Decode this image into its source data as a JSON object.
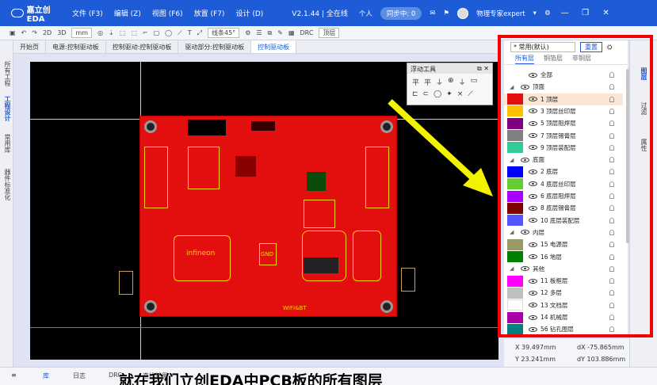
{
  "titlebar": {
    "app_name": "嘉立创EDA",
    "menus": [
      "文件 (F3)",
      "编辑 (Z)",
      "视图 (F6)",
      "放置 (F7)",
      "设计 (D)"
    ],
    "version": "V2.1.44 | 全在线",
    "mode": "个人",
    "sync": "同步中: 0",
    "user": "物理专家expert"
  },
  "toolbar": {
    "items": [
      "2D",
      "3D",
      "mm",
      "线条45°",
      "DRC",
      "顶层"
    ]
  },
  "left_tabs": [
    "所有工程",
    "工程设计",
    "常用库",
    "器件标准化"
  ],
  "doc_tabs": [
    "开始页",
    "电源:控制驱动板",
    "控制驱动:控制驱动板",
    "驱动部分:控制驱动板",
    "控制驱动板"
  ],
  "float_panel": {
    "title": "浮动工具",
    "row1": [
      "平",
      "平",
      "⏚",
      "⊕",
      "⏚",
      "▭"
    ],
    "row2": [
      "⊏",
      "⊂",
      "◯",
      "✦",
      "×",
      "⟋"
    ]
  },
  "layers_panel": {
    "combo": "* 常用(默认)",
    "reset": "重置",
    "subtabs": [
      "所有层",
      "铜箔层",
      "非铜层"
    ],
    "rows": [
      {
        "type": "item",
        "label": "全部",
        "color": ""
      },
      {
        "type": "group",
        "label": "顶面",
        "color": ""
      },
      {
        "type": "item",
        "label": "1 顶层",
        "color": "#e30e0e",
        "selected": true
      },
      {
        "type": "item",
        "label": "3 顶层丝印层",
        "color": "#ffc000"
      },
      {
        "type": "item",
        "label": "5 顶层阻焊层",
        "color": "#800080"
      },
      {
        "type": "item",
        "label": "7 顶层锡膏层",
        "color": "#808080"
      },
      {
        "type": "item",
        "label": "9 顶层装配层",
        "color": "#33cc99"
      },
      {
        "type": "group",
        "label": "底面",
        "color": ""
      },
      {
        "type": "item",
        "label": "2 底层",
        "color": "#0000ff"
      },
      {
        "type": "item",
        "label": "4 底层丝印层",
        "color": "#66cc33"
      },
      {
        "type": "item",
        "label": "6 底层阻焊层",
        "color": "#aa00ff"
      },
      {
        "type": "item",
        "label": "8 底层锡膏层",
        "color": "#800000"
      },
      {
        "type": "item",
        "label": "10 底层装配层",
        "color": "#5555ff"
      },
      {
        "type": "group",
        "label": "内层",
        "color": ""
      },
      {
        "type": "item",
        "label": "15 电源层",
        "color": "#999966"
      },
      {
        "type": "item",
        "label": "16 地层",
        "color": "#008000"
      },
      {
        "type": "group",
        "label": "其他",
        "color": ""
      },
      {
        "type": "item",
        "label": "11 板框层",
        "color": "#ff00ff"
      },
      {
        "type": "item",
        "label": "12 多层",
        "color": "#c0c0c0"
      },
      {
        "type": "item",
        "label": "13 文档层",
        "color": "#ffffff"
      },
      {
        "type": "item",
        "label": "14 机械层",
        "color": "#aa00aa"
      },
      {
        "type": "item",
        "label": "56 钻孔图层",
        "color": "#008080"
      }
    ]
  },
  "right_tabs": [
    "图层",
    "过滤",
    "属性"
  ],
  "coords": {
    "x": "X  39.497mm",
    "dx": "dX  -75.865mm",
    "y": "Y  23.241mm",
    "dy": "dY  103.886mm"
  },
  "bottom_tabs": [
    "库",
    "日志",
    "DRC",
    "查找结果"
  ],
  "subtitle": "就在我们立创EDA中PCB板的所有图层",
  "pcb_labels": {
    "logo": "infineon",
    "gnd": "GND",
    "wifi": "WIFI&BT"
  }
}
